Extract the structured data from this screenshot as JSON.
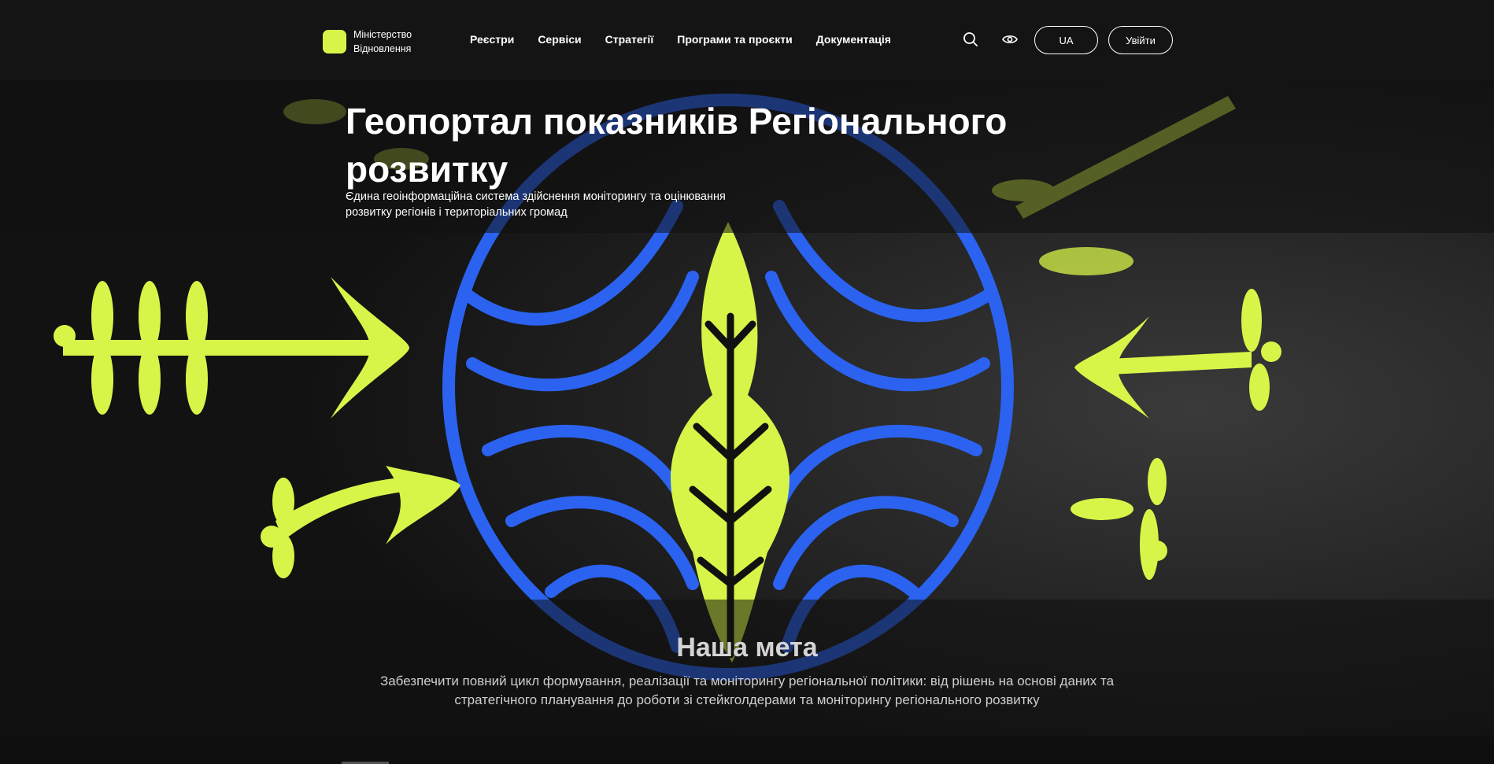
{
  "header": {
    "logo_line1": "Міністерство",
    "logo_line2": "Відновлення",
    "nav": [
      "Реєстри",
      "Сервіси",
      "Стратегії",
      "Програми та проєкти",
      "Документація"
    ],
    "search_icon": "search-icon",
    "accessibility_icon": "eye-icon",
    "lang_label": "UA",
    "login_label": "Увійти"
  },
  "hero": {
    "title": "Геопортал показників Регіонального розвитку",
    "subtitle": "Єдина геоінформаційна система здійснення моніторингу та оцінювання розвитку регіонів і територіальних громад"
  },
  "mission": {
    "title": "Наша мета",
    "text": "Забезпечити повний цикл формування, реалізації та моніторингу регіональної політики: від рішень на основі даних та стратегічного планування до роботи зі стейкголдерами та моніторингу регіонального розвитку"
  },
  "colors": {
    "accent_lime": "#d7f548",
    "accent_blue": "#2b63f0",
    "background": "#111111"
  }
}
